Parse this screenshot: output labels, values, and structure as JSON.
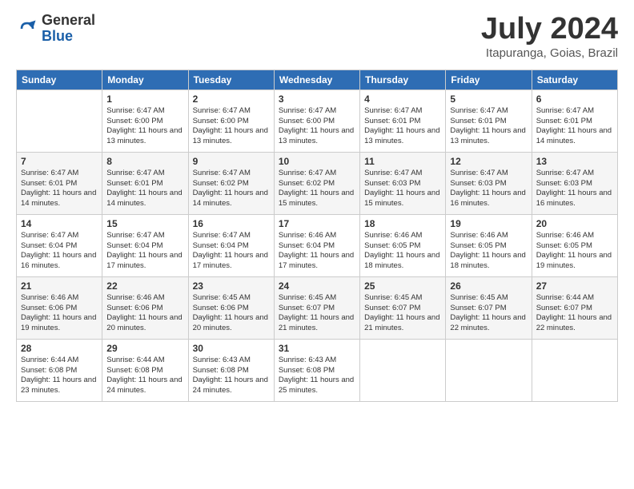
{
  "header": {
    "logo_general": "General",
    "logo_blue": "Blue",
    "month_year": "July 2024",
    "location": "Itapuranga, Goias, Brazil"
  },
  "weekdays": [
    "Sunday",
    "Monday",
    "Tuesday",
    "Wednesday",
    "Thursday",
    "Friday",
    "Saturday"
  ],
  "weeks": [
    [
      {
        "day": "",
        "sunrise": "",
        "sunset": "",
        "daylight": ""
      },
      {
        "day": "1",
        "sunrise": "Sunrise: 6:47 AM",
        "sunset": "Sunset: 6:00 PM",
        "daylight": "Daylight: 11 hours and 13 minutes."
      },
      {
        "day": "2",
        "sunrise": "Sunrise: 6:47 AM",
        "sunset": "Sunset: 6:00 PM",
        "daylight": "Daylight: 11 hours and 13 minutes."
      },
      {
        "day": "3",
        "sunrise": "Sunrise: 6:47 AM",
        "sunset": "Sunset: 6:00 PM",
        "daylight": "Daylight: 11 hours and 13 minutes."
      },
      {
        "day": "4",
        "sunrise": "Sunrise: 6:47 AM",
        "sunset": "Sunset: 6:01 PM",
        "daylight": "Daylight: 11 hours and 13 minutes."
      },
      {
        "day": "5",
        "sunrise": "Sunrise: 6:47 AM",
        "sunset": "Sunset: 6:01 PM",
        "daylight": "Daylight: 11 hours and 13 minutes."
      },
      {
        "day": "6",
        "sunrise": "Sunrise: 6:47 AM",
        "sunset": "Sunset: 6:01 PM",
        "daylight": "Daylight: 11 hours and 14 minutes."
      }
    ],
    [
      {
        "day": "7",
        "sunrise": "Sunrise: 6:47 AM",
        "sunset": "Sunset: 6:01 PM",
        "daylight": "Daylight: 11 hours and 14 minutes."
      },
      {
        "day": "8",
        "sunrise": "Sunrise: 6:47 AM",
        "sunset": "Sunset: 6:01 PM",
        "daylight": "Daylight: 11 hours and 14 minutes."
      },
      {
        "day": "9",
        "sunrise": "Sunrise: 6:47 AM",
        "sunset": "Sunset: 6:02 PM",
        "daylight": "Daylight: 11 hours and 14 minutes."
      },
      {
        "day": "10",
        "sunrise": "Sunrise: 6:47 AM",
        "sunset": "Sunset: 6:02 PM",
        "daylight": "Daylight: 11 hours and 15 minutes."
      },
      {
        "day": "11",
        "sunrise": "Sunrise: 6:47 AM",
        "sunset": "Sunset: 6:03 PM",
        "daylight": "Daylight: 11 hours and 15 minutes."
      },
      {
        "day": "12",
        "sunrise": "Sunrise: 6:47 AM",
        "sunset": "Sunset: 6:03 PM",
        "daylight": "Daylight: 11 hours and 16 minutes."
      },
      {
        "day": "13",
        "sunrise": "Sunrise: 6:47 AM",
        "sunset": "Sunset: 6:03 PM",
        "daylight": "Daylight: 11 hours and 16 minutes."
      }
    ],
    [
      {
        "day": "14",
        "sunrise": "Sunrise: 6:47 AM",
        "sunset": "Sunset: 6:04 PM",
        "daylight": "Daylight: 11 hours and 16 minutes."
      },
      {
        "day": "15",
        "sunrise": "Sunrise: 6:47 AM",
        "sunset": "Sunset: 6:04 PM",
        "daylight": "Daylight: 11 hours and 17 minutes."
      },
      {
        "day": "16",
        "sunrise": "Sunrise: 6:47 AM",
        "sunset": "Sunset: 6:04 PM",
        "daylight": "Daylight: 11 hours and 17 minutes."
      },
      {
        "day": "17",
        "sunrise": "Sunrise: 6:46 AM",
        "sunset": "Sunset: 6:04 PM",
        "daylight": "Daylight: 11 hours and 17 minutes."
      },
      {
        "day": "18",
        "sunrise": "Sunrise: 6:46 AM",
        "sunset": "Sunset: 6:05 PM",
        "daylight": "Daylight: 11 hours and 18 minutes."
      },
      {
        "day": "19",
        "sunrise": "Sunrise: 6:46 AM",
        "sunset": "Sunset: 6:05 PM",
        "daylight": "Daylight: 11 hours and 18 minutes."
      },
      {
        "day": "20",
        "sunrise": "Sunrise: 6:46 AM",
        "sunset": "Sunset: 6:05 PM",
        "daylight": "Daylight: 11 hours and 19 minutes."
      }
    ],
    [
      {
        "day": "21",
        "sunrise": "Sunrise: 6:46 AM",
        "sunset": "Sunset: 6:06 PM",
        "daylight": "Daylight: 11 hours and 19 minutes."
      },
      {
        "day": "22",
        "sunrise": "Sunrise: 6:46 AM",
        "sunset": "Sunset: 6:06 PM",
        "daylight": "Daylight: 11 hours and 20 minutes."
      },
      {
        "day": "23",
        "sunrise": "Sunrise: 6:45 AM",
        "sunset": "Sunset: 6:06 PM",
        "daylight": "Daylight: 11 hours and 20 minutes."
      },
      {
        "day": "24",
        "sunrise": "Sunrise: 6:45 AM",
        "sunset": "Sunset: 6:07 PM",
        "daylight": "Daylight: 11 hours and 21 minutes."
      },
      {
        "day": "25",
        "sunrise": "Sunrise: 6:45 AM",
        "sunset": "Sunset: 6:07 PM",
        "daylight": "Daylight: 11 hours and 21 minutes."
      },
      {
        "day": "26",
        "sunrise": "Sunrise: 6:45 AM",
        "sunset": "Sunset: 6:07 PM",
        "daylight": "Daylight: 11 hours and 22 minutes."
      },
      {
        "day": "27",
        "sunrise": "Sunrise: 6:44 AM",
        "sunset": "Sunset: 6:07 PM",
        "daylight": "Daylight: 11 hours and 22 minutes."
      }
    ],
    [
      {
        "day": "28",
        "sunrise": "Sunrise: 6:44 AM",
        "sunset": "Sunset: 6:08 PM",
        "daylight": "Daylight: 11 hours and 23 minutes."
      },
      {
        "day": "29",
        "sunrise": "Sunrise: 6:44 AM",
        "sunset": "Sunset: 6:08 PM",
        "daylight": "Daylight: 11 hours and 24 minutes."
      },
      {
        "day": "30",
        "sunrise": "Sunrise: 6:43 AM",
        "sunset": "Sunset: 6:08 PM",
        "daylight": "Daylight: 11 hours and 24 minutes."
      },
      {
        "day": "31",
        "sunrise": "Sunrise: 6:43 AM",
        "sunset": "Sunset: 6:08 PM",
        "daylight": "Daylight: 11 hours and 25 minutes."
      },
      {
        "day": "",
        "sunrise": "",
        "sunset": "",
        "daylight": ""
      },
      {
        "day": "",
        "sunrise": "",
        "sunset": "",
        "daylight": ""
      },
      {
        "day": "",
        "sunrise": "",
        "sunset": "",
        "daylight": ""
      }
    ]
  ]
}
